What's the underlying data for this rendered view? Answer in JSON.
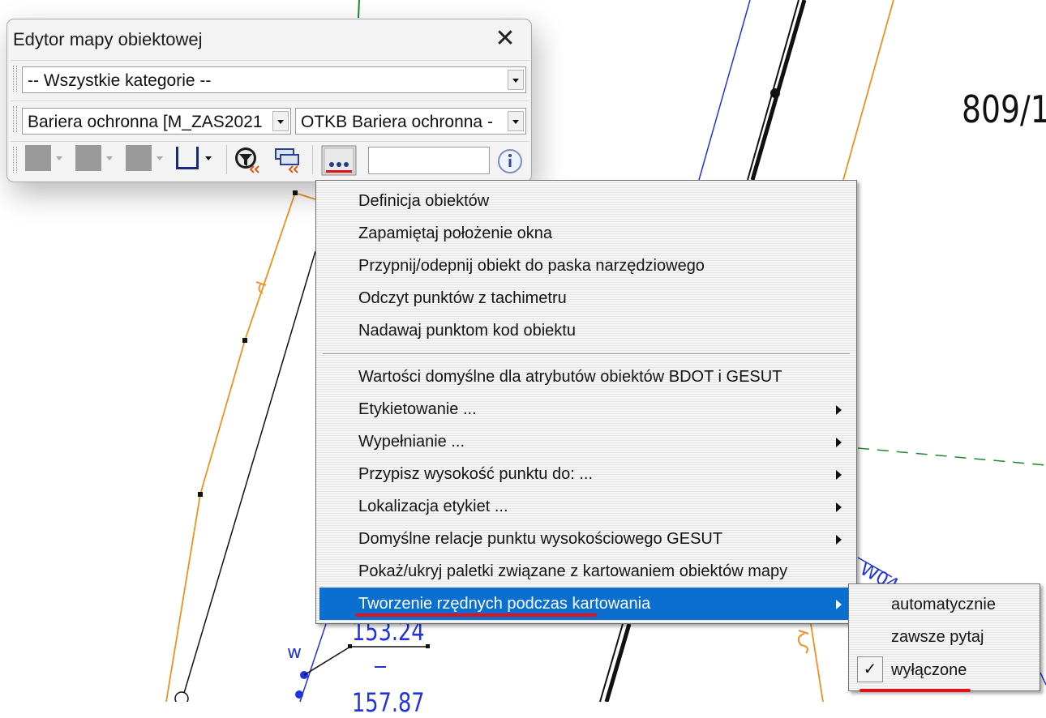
{
  "map": {
    "parcel_label": "809/1",
    "height_labels": [
      "153.24",
      "157.87"
    ],
    "point_letter": "w",
    "road_label": "W04"
  },
  "editor": {
    "title": "Edytor mapy obiektowej",
    "category_combo": "-- Wszystkie kategorie --",
    "object_combo": "Bariera ochronna [M_ZAS2021",
    "code_combo": "OTKB Bariera ochronna -",
    "input_value": "",
    "toolbar_icons": [
      "color-swatch",
      "color-swatch",
      "color-swatch",
      "line-style",
      "filter",
      "layers",
      "cartography-points",
      "info"
    ]
  },
  "context_menu": {
    "group1": [
      {
        "label": "Definicja obiektów"
      },
      {
        "label": "Zapamiętaj położenie okna"
      },
      {
        "label": "Przypnij/odepnij obiekt do paska narzędziowego"
      },
      {
        "label": "Odczyt punktów z tachimetru"
      },
      {
        "label": "Nadawaj punktom kod obiektu"
      }
    ],
    "group2": [
      {
        "label": "Wartości domyślne dla atrybutów obiektów BDOT i GESUT"
      },
      {
        "label": "Etykietowanie ..."
      },
      {
        "label": "Wypełnianie ..."
      },
      {
        "label": "Przypisz wysokość punktu do: ..."
      },
      {
        "label": "Lokalizacja etykiet ..."
      },
      {
        "label": "Domyślne relacje punktu wysokościowego GESUT"
      },
      {
        "label": "Pokaż/ukryj paletki związane z kartowaniem obiektów mapy"
      },
      {
        "label": "Tworzenie rzędnych podczas kartowania"
      }
    ]
  },
  "submenu": {
    "items": [
      {
        "label": "automatycznie",
        "checked": false
      },
      {
        "label": "zawsze pytaj",
        "checked": false
      },
      {
        "label": "wyłączone",
        "checked": true
      }
    ]
  },
  "colors": {
    "selection": "#0a6fd1",
    "annotation_underline": "#e0131b",
    "map_orange": "#f0901e",
    "map_blue": "#2233dd",
    "map_green": "#1e8a2e"
  }
}
